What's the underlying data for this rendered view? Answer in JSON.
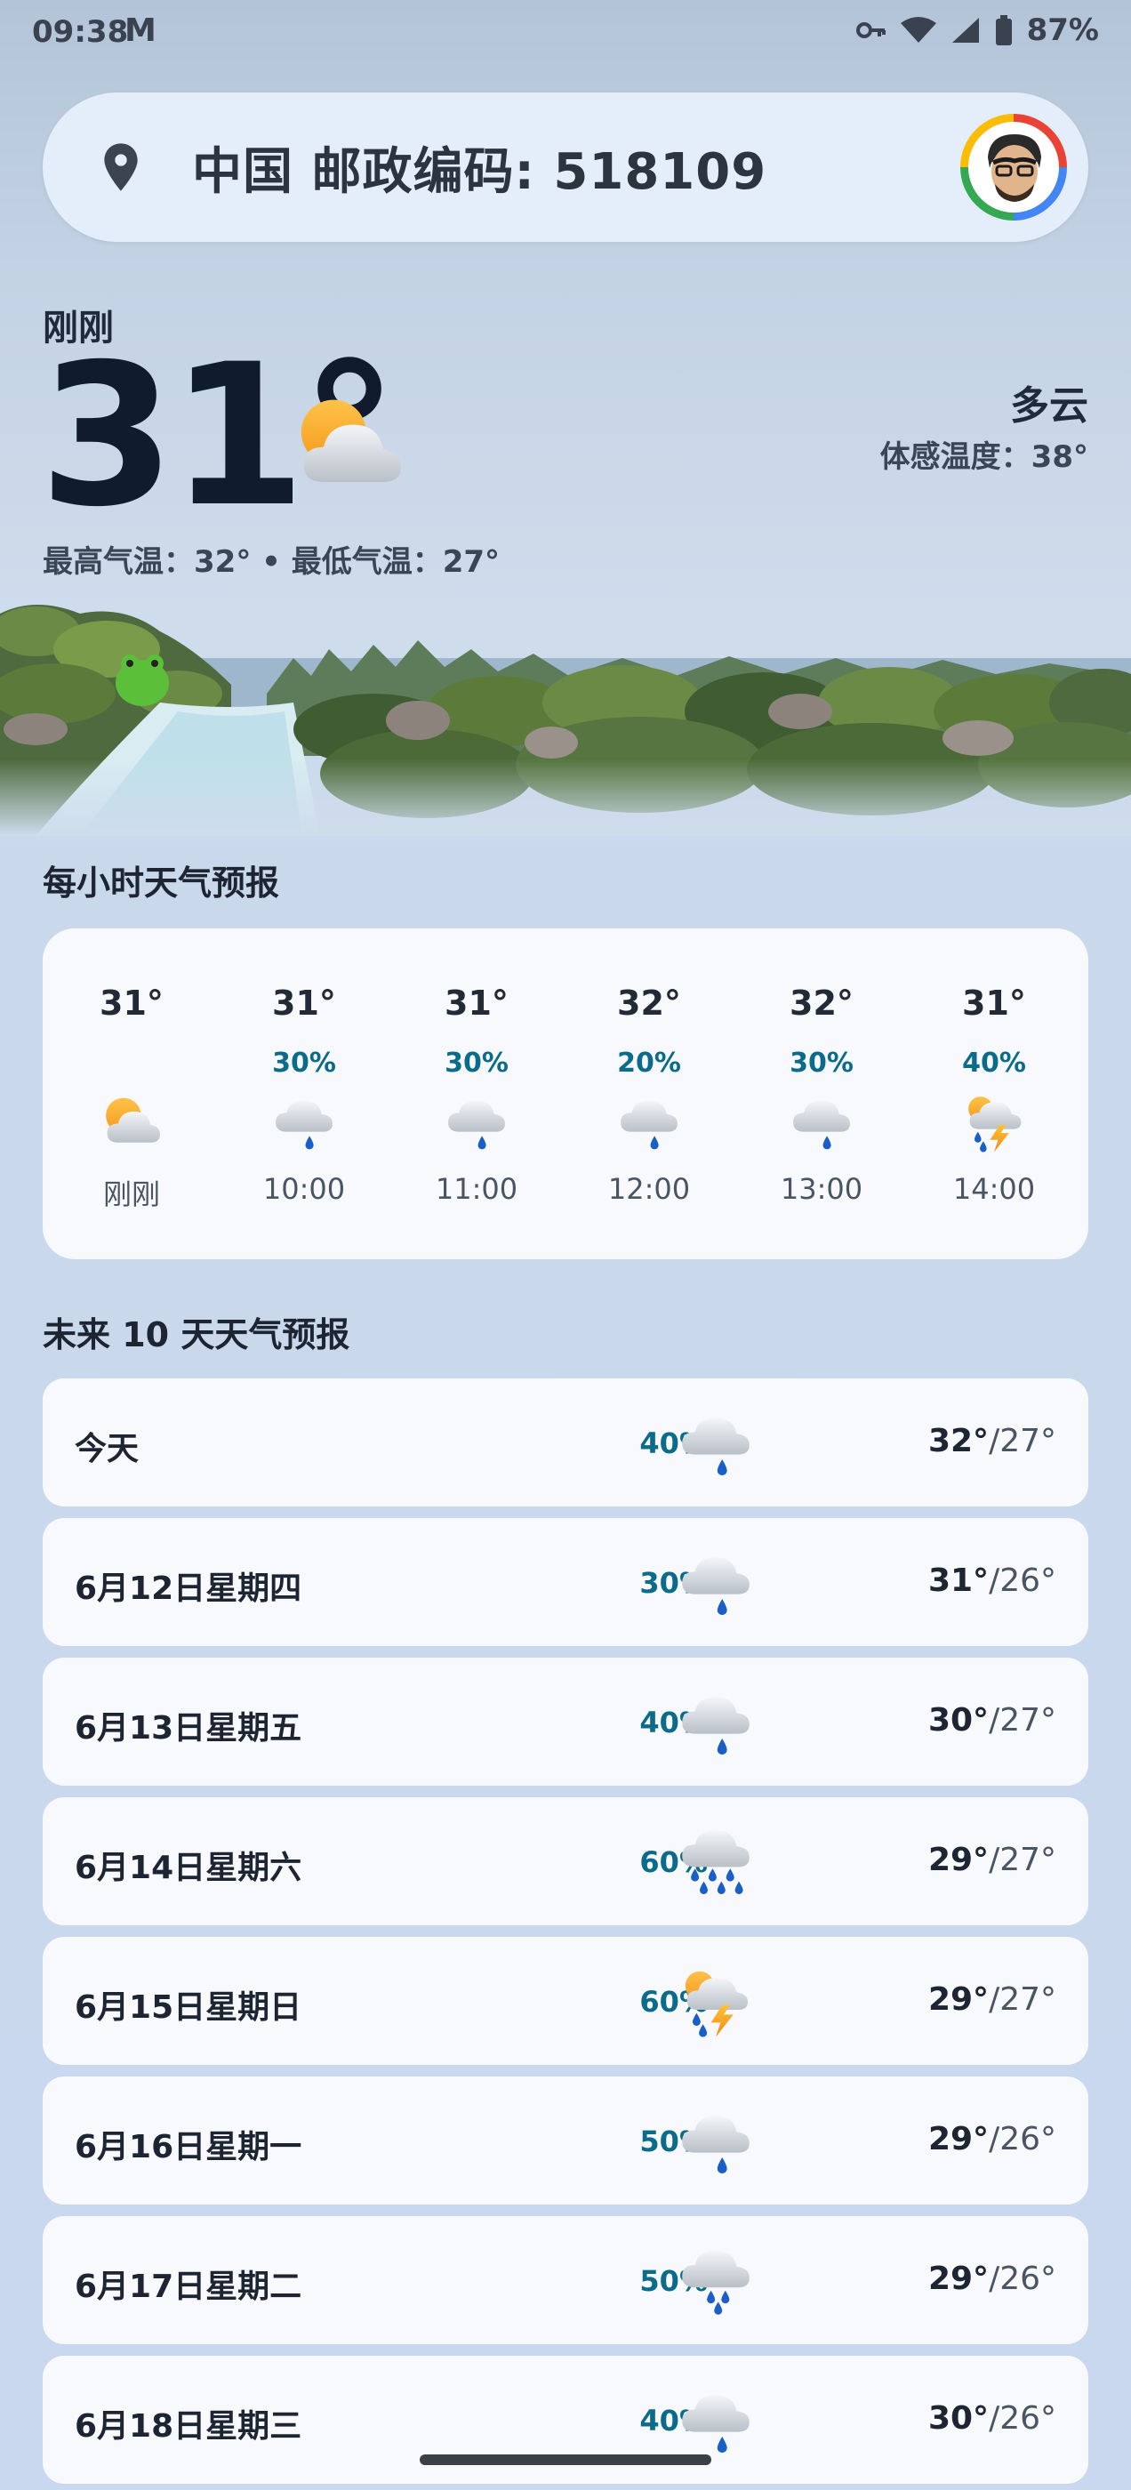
{
  "status_bar": {
    "time": "09:38",
    "mail_glyph": "M",
    "battery": "87%"
  },
  "search": {
    "location": "中国 邮政编码: 518109"
  },
  "current": {
    "label": "刚刚",
    "temp": "31°",
    "condition": "多云",
    "feels_like": "体感温度：38°",
    "high_low": "最高气温：32° • 最低气温：27°"
  },
  "hourly": {
    "title": "每小时天气预报",
    "items": [
      {
        "temp": "31°",
        "precip": "",
        "time": "刚刚",
        "icon": "partly-cloudy-icon"
      },
      {
        "temp": "31°",
        "precip": "30%",
        "time": "10:00",
        "icon": "light-rain-icon"
      },
      {
        "temp": "31°",
        "precip": "30%",
        "time": "11:00",
        "icon": "light-rain-icon"
      },
      {
        "temp": "32°",
        "precip": "20%",
        "time": "12:00",
        "icon": "light-rain-icon"
      },
      {
        "temp": "32°",
        "precip": "30%",
        "time": "13:00",
        "icon": "light-rain-icon"
      },
      {
        "temp": "31°",
        "precip": "40%",
        "time": "14:00",
        "icon": "thunderstorm-icon"
      }
    ]
  },
  "daily": {
    "title": "未来 10 天天气预报",
    "items": [
      {
        "day": "今天",
        "precip": "40%",
        "high": "32°",
        "low": "/27°",
        "icon": "light-rain-icon"
      },
      {
        "day": "6月12日星期四",
        "precip": "30%",
        "high": "31°",
        "low": "/26°",
        "icon": "light-rain-icon"
      },
      {
        "day": "6月13日星期五",
        "precip": "40%",
        "high": "30°",
        "low": "/27°",
        "icon": "light-rain-icon"
      },
      {
        "day": "6月14日星期六",
        "precip": "60%",
        "high": "29°",
        "low": "/27°",
        "icon": "heavy-rain-icon"
      },
      {
        "day": "6月15日星期日",
        "precip": "60%",
        "high": "29°",
        "low": "/27°",
        "icon": "thunderstorm-icon"
      },
      {
        "day": "6月16日星期一",
        "precip": "50%",
        "high": "29°",
        "low": "/26°",
        "icon": "light-rain-icon"
      },
      {
        "day": "6月17日星期二",
        "precip": "50%",
        "high": "29°",
        "low": "/26°",
        "icon": "rain-icon"
      },
      {
        "day": "6月18日星期三",
        "precip": "40%",
        "high": "30°",
        "low": "/26°",
        "icon": "light-rain-icon"
      }
    ]
  },
  "colors": {
    "precip": "#0b6b8a",
    "card": "#f8f9fc",
    "rain_drop": "#1a5fc8"
  }
}
